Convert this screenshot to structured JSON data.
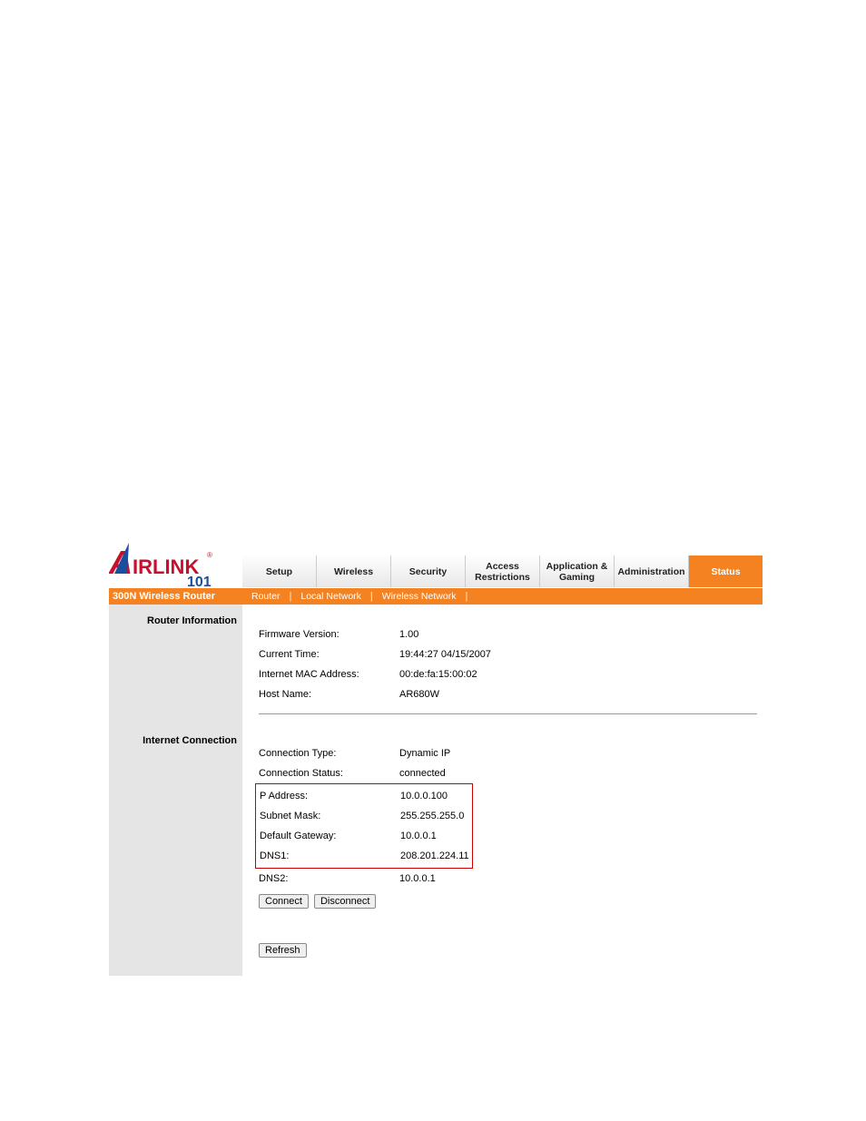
{
  "logo": {
    "brand_left": "A",
    "brand_rest": "IRLINK",
    "reg": "®",
    "sub": "101"
  },
  "tabs": {
    "setup": "Setup",
    "wireless": "Wireless",
    "security": "Security",
    "access": "Access\nRestrictions",
    "gaming": "Application &\nGaming",
    "admin": "Administration",
    "status": "Status"
  },
  "model": "300N Wireless Router",
  "subnav": {
    "router": "Router",
    "local": "Local Network",
    "wireless": "Wireless Network"
  },
  "sections": {
    "router_info_hdr": "Router Information",
    "internet_hdr": "Internet Connection"
  },
  "router_info": {
    "firmware_lbl": "Firmware Version:",
    "firmware_val": "1.00",
    "time_lbl": "Current Time:",
    "time_val": "19:44:27 04/15/2007",
    "mac_lbl": "Internet MAC Address:",
    "mac_val": "00:de:fa:15:00:02",
    "host_lbl": "Host Name:",
    "host_val": "AR680W"
  },
  "internet": {
    "type_lbl": "Connection Type:",
    "type_val": "Dynamic IP",
    "status_lbl": "Connection Status:",
    "status_val": "connected",
    "ip_lbl": "P Address:",
    "ip_val": "10.0.0.100",
    "mask_lbl": "Subnet Mask:",
    "mask_val": "255.255.255.0",
    "gw_lbl": "Default Gateway:",
    "gw_val": "10.0.0.1",
    "dns1_lbl": "DNS1:",
    "dns1_val": "208.201.224.11",
    "dns2_lbl": "DNS2:",
    "dns2_val": "10.0.0.1"
  },
  "buttons": {
    "connect": "Connect",
    "disconnect": "Disconnect",
    "refresh": "Refresh"
  }
}
